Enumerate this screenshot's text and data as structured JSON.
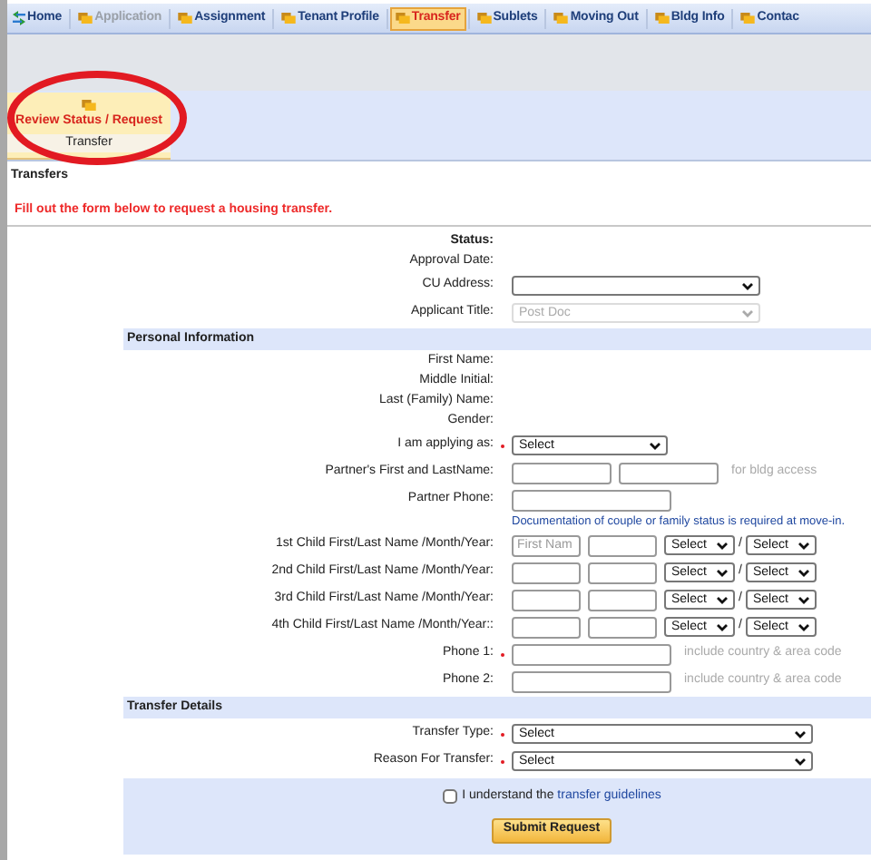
{
  "nav": {
    "tabs": [
      {
        "label": "Home",
        "kind": "home",
        "selected": false,
        "disabled": false
      },
      {
        "label": "Application",
        "kind": "page",
        "selected": false,
        "disabled": true
      },
      {
        "label": "Assignment",
        "kind": "page",
        "selected": false,
        "disabled": false
      },
      {
        "label": "Tenant Profile",
        "kind": "page",
        "selected": false,
        "disabled": false
      },
      {
        "label": "Transfer",
        "kind": "page",
        "selected": true,
        "disabled": false
      },
      {
        "label": "Sublets",
        "kind": "page",
        "selected": false,
        "disabled": false
      },
      {
        "label": "Moving Out",
        "kind": "page",
        "selected": false,
        "disabled": false
      },
      {
        "label": "Bldg Info",
        "kind": "page",
        "selected": false,
        "disabled": false
      },
      {
        "label": "Contac",
        "kind": "page",
        "selected": false,
        "disabled": false
      }
    ]
  },
  "submenu": {
    "title": "Review Status / Request",
    "subtitle": "Transfer",
    "circled": true
  },
  "page_title": "Transfers",
  "instruction": "Fill out the form below to request a housing transfer.",
  "sections": [
    {
      "rows": [
        {
          "label": "Status:",
          "bold": true,
          "required": false,
          "controls": []
        },
        {
          "label": "Approval Date:",
          "bold": false,
          "required": false,
          "controls": []
        },
        {
          "label": "CU Address:",
          "bold": false,
          "required": false,
          "controls": [
            {
              "kind": "select-medium",
              "disabled": false
            }
          ]
        },
        {
          "label": "Applicant Title:",
          "bold": false,
          "required": false,
          "controls": [
            {
              "kind": "select-medium",
              "value": "Post Doc",
              "disabled": true
            }
          ]
        }
      ]
    },
    {
      "heading": "Personal Information",
      "rows": [
        {
          "label": "First Name:",
          "bold": false,
          "required": false,
          "controls": []
        },
        {
          "label": "Middle Initial:",
          "bold": false,
          "required": false,
          "controls": []
        },
        {
          "label": "Last (Family) Name:",
          "bold": false,
          "required": false,
          "controls": []
        },
        {
          "label": "Gender:",
          "bold": false,
          "required": false,
          "controls": []
        },
        {
          "label": "I am applying as:",
          "bold": false,
          "required": true,
          "controls": [
            {
              "kind": "select-short",
              "value": "Select",
              "disabled": false
            }
          ]
        },
        {
          "label": "Partner's First and LastName:",
          "bold": false,
          "required": false,
          "controls": [
            {
              "kind": "input-short"
            },
            {
              "kind": "input-short"
            },
            {
              "kind": "hint",
              "text": "for bldg access"
            }
          ]
        },
        {
          "label": "Partner Phone:",
          "bold": false,
          "required": false,
          "controls": [
            {
              "kind": "input-medium"
            }
          ]
        },
        {
          "controls": [
            {
              "kind": "note",
              "text": "Documentation of couple or family status is required at move-in."
            }
          ]
        },
        {
          "label": "1st Child First/Last Name /Month/Year:",
          "bold": false,
          "required": false,
          "controls": [
            {
              "kind": "input-tiny",
              "placeholder": "First Nam"
            },
            {
              "kind": "input-tiny"
            },
            {
              "kind": "select-tiny",
              "value": "Select",
              "disabled": false
            },
            {
              "kind": "separator",
              "text": "/"
            },
            {
              "kind": "select-tiny",
              "value": "Select",
              "disabled": false
            }
          ]
        },
        {
          "label": "2nd Child First/Last Name /Month/Year:",
          "bold": false,
          "required": false,
          "controls": [
            {
              "kind": "input-tiny"
            },
            {
              "kind": "input-tiny"
            },
            {
              "kind": "select-tiny",
              "value": "Select",
              "disabled": false
            },
            {
              "kind": "separator",
              "text": "/"
            },
            {
              "kind": "select-tiny",
              "value": "Select",
              "disabled": false
            }
          ]
        },
        {
          "label": "3rd Child First/Last Name /Month/Year:",
          "bold": false,
          "required": false,
          "controls": [
            {
              "kind": "input-tiny"
            },
            {
              "kind": "input-tiny"
            },
            {
              "kind": "select-tiny",
              "value": "Select",
              "disabled": false
            },
            {
              "kind": "separator",
              "text": "/"
            },
            {
              "kind": "select-tiny",
              "value": "Select",
              "disabled": false
            }
          ]
        },
        {
          "label": "4th Child First/Last Name /Month/Year::",
          "bold": false,
          "required": false,
          "controls": [
            {
              "kind": "input-tiny"
            },
            {
              "kind": "input-tiny"
            },
            {
              "kind": "select-tiny",
              "value": "Select",
              "disabled": false
            },
            {
              "kind": "separator",
              "text": "/"
            },
            {
              "kind": "select-tiny",
              "value": "Select",
              "disabled": false
            }
          ]
        },
        {
          "label": "Phone 1:",
          "bold": false,
          "required": true,
          "controls": [
            {
              "kind": "input-medium"
            },
            {
              "kind": "hint",
              "text": "include country & area code"
            }
          ]
        },
        {
          "label": "Phone 2:",
          "bold": false,
          "required": false,
          "controls": [
            {
              "kind": "input-medium"
            },
            {
              "kind": "hint",
              "text": "include country & area code"
            }
          ]
        }
      ]
    },
    {
      "heading": "Transfer Details",
      "rows": [
        {
          "label": "Transfer Type:",
          "bold": false,
          "required": true,
          "controls": [
            {
              "kind": "select-long",
              "value": "Select",
              "disabled": false
            }
          ]
        },
        {
          "label": "Reason For Transfer:",
          "bold": false,
          "required": true,
          "controls": [
            {
              "kind": "select-long",
              "value": "Select",
              "disabled": false
            }
          ]
        }
      ]
    }
  ],
  "agreement": {
    "checked": false,
    "text": "I understand the",
    "link": "transfer guidelines"
  },
  "submit": "Submit Request"
}
